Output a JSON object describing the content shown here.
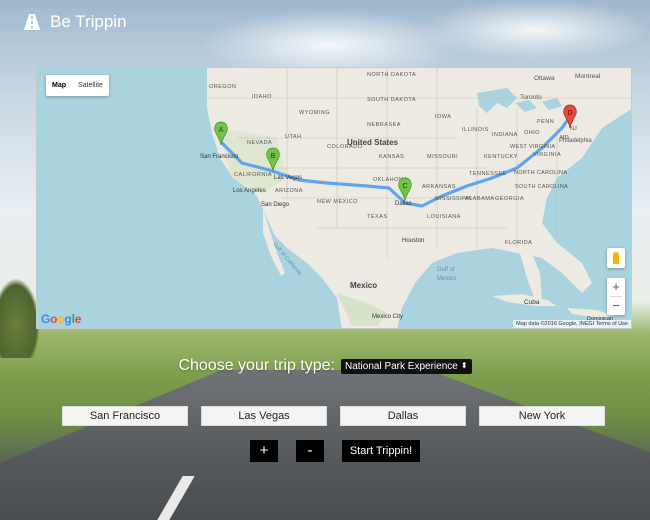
{
  "brand": {
    "name": "Be Trippin"
  },
  "map": {
    "map_type_buttons": [
      "Map",
      "Satellite"
    ],
    "active_map_type": "Map",
    "zoom_in": "+",
    "zoom_out": "−",
    "google_logo": "Google",
    "attribution": "Map data ©2016 Google, INEGI   Terms of Use",
    "markers": [
      "A",
      "B",
      "C",
      "D"
    ],
    "labels": {
      "ottawa": "Ottawa",
      "montreal": "Montreal",
      "toronto": "Toronto",
      "north_dakota": "NORTH DAKOTA",
      "south_dakota": "SOUTH DAKOTA",
      "wyoming": "WYOMING",
      "nebraska": "NEBRASKA",
      "iowa": "IOWA",
      "utah": "UTAH",
      "colorado": "COLORADO",
      "kansas": "KANSAS",
      "missouri": "MISSOURI",
      "illinois": "ILLINOIS",
      "ohio": "OHIO",
      "penn": "PENN",
      "indiana": "INDIANA",
      "kentucky": "KENTUCKY",
      "west_virginia": "WEST VIRGINIA",
      "virginia": "VIRGINIA",
      "tennessee": "TENNESSEE",
      "north_carolina": "NORTH CAROLINA",
      "south_carolina": "SOUTH CAROLINA",
      "arkansas": "ARKANSAS",
      "oklahoma": "OKLAHOMA",
      "mississippi": "MISSISSIPPI",
      "alabama": "ALABAMA",
      "georgia": "GEORGIA",
      "louisiana": "LOUISIANA",
      "texas": "TEXAS",
      "new_mexico": "NEW MEXICO",
      "arizona": "ARIZONA",
      "nevada": "NEVADA",
      "california": "CALIFORNIA",
      "oregon": "OREGON",
      "idaho": "IDAHO",
      "united_states": "United States",
      "san_francisco": "San Francisco",
      "las_vegas": "Las Vegas",
      "los_angeles": "Los Angeles",
      "san_diego": "San Diego",
      "dallas": "Dallas",
      "houston": "Houston",
      "philadelphia": "Philadelphia",
      "nj": "NJ",
      "md": "MD",
      "florida": "FLORIDA",
      "mexico": "Mexico",
      "mexico_city": "Mexico City",
      "gulf_of_mexico": "Gulf of\nMexico",
      "gulf_of_california": "Gulf of California",
      "cuba": "Cuba",
      "dominican": "Dominican"
    }
  },
  "trip": {
    "label": "Choose your trip type:",
    "selected_option": "National Park Experience",
    "select_arrow": "⬍"
  },
  "cities": [
    "San Francisco",
    "Las Vegas",
    "Dallas",
    "New York"
  ],
  "buttons": {
    "add": "+",
    "remove": "-",
    "start": "Start Trippin!"
  },
  "colors": {
    "route": "#4e9df2",
    "marker_green": "#74c24a",
    "marker_red": "#e64a3b",
    "water": "#a9d3df",
    "land": "#eceae2"
  }
}
